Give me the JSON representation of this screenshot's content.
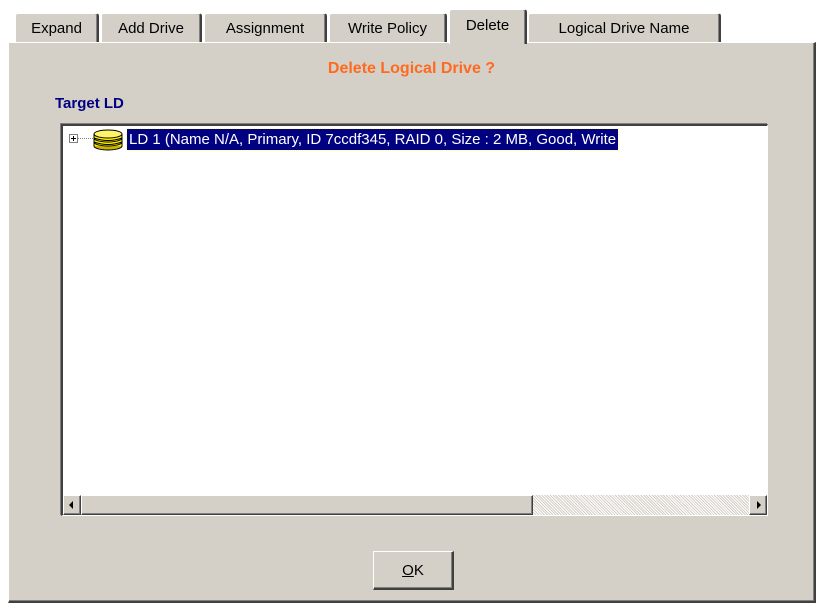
{
  "tabs": [
    {
      "label": "Expand",
      "selected": false
    },
    {
      "label": "Add Drive",
      "selected": false
    },
    {
      "label": "Assignment",
      "selected": false
    },
    {
      "label": "Write Policy",
      "selected": false
    },
    {
      "label": "Delete",
      "selected": true
    },
    {
      "label": "Logical Drive Name",
      "selected": false
    }
  ],
  "panel": {
    "title": "Delete Logical Drive ?",
    "title_color": "#ff6a1f"
  },
  "target_group": {
    "label": "Target LD",
    "label_color": "#000080",
    "tree": {
      "items": [
        {
          "label": "LD 1 (Name N/A, Primary, ID 7ccdf345, RAID 0, Size : 2 MB, Good, Write",
          "icon": "disk-stack-icon",
          "expander": "plus",
          "selected": true
        }
      ],
      "selection_color": "#000080"
    }
  },
  "ok_button": {
    "mnemonic": "O",
    "rest": "K"
  }
}
